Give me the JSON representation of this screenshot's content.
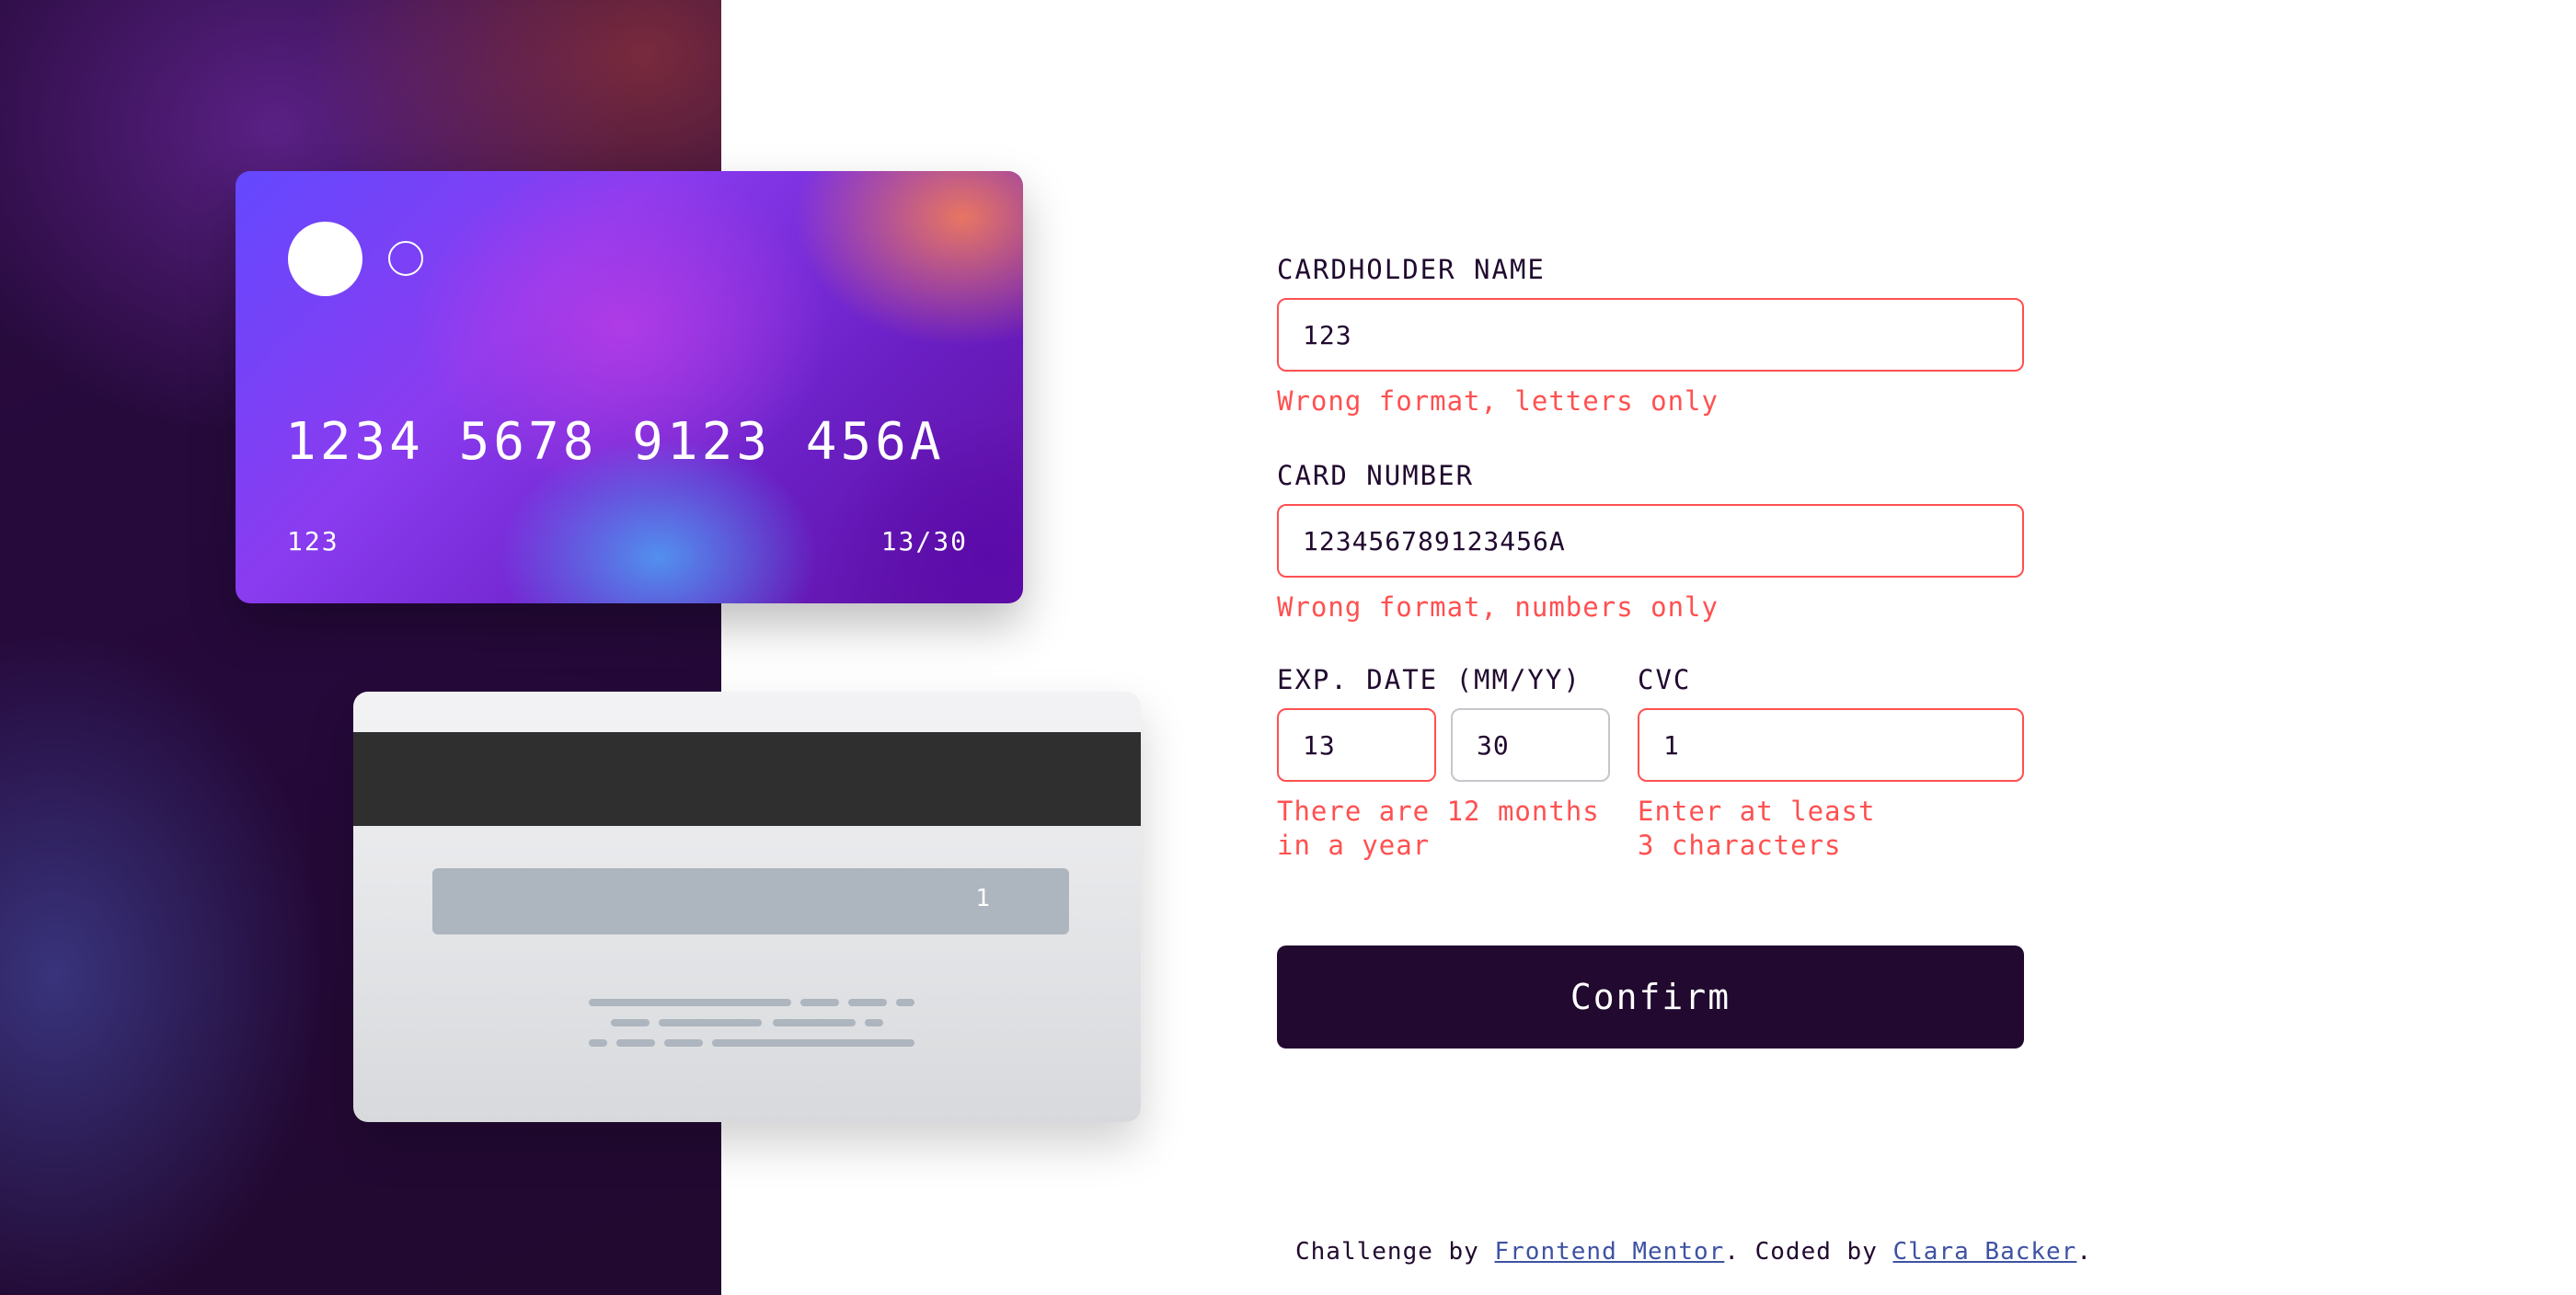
{
  "card_front": {
    "number": "1234 5678 9123 456A",
    "name": "123",
    "exp_month": "13",
    "exp_separator": "/",
    "exp_year": "30"
  },
  "card_back": {
    "cvc": "1"
  },
  "form": {
    "name": {
      "label": "CARDHOLDER NAME",
      "value": "123",
      "error": "Wrong format, letters only"
    },
    "number": {
      "label": "CARD NUMBER",
      "value": "123456789123456A",
      "error": "Wrong format, numbers only"
    },
    "exp": {
      "label": "EXP. DATE (MM/YY)",
      "month_value": "13",
      "year_value": "30",
      "error_line1": "There are 12 months",
      "error_line2": "in a year"
    },
    "cvc": {
      "label": "CVC",
      "value": "1",
      "error_line1": "Enter at least",
      "error_line2": "3 characters"
    },
    "submit_label": "Confirm"
  },
  "footer": {
    "prefix": "Challenge by ",
    "link1": "Frontend Mentor",
    "middle": ". Coded by ",
    "link2": "Clara Backer",
    "suffix": "."
  },
  "colors": {
    "error": "#ff5050",
    "dark": "#21092f",
    "link": "#3e52a3"
  }
}
